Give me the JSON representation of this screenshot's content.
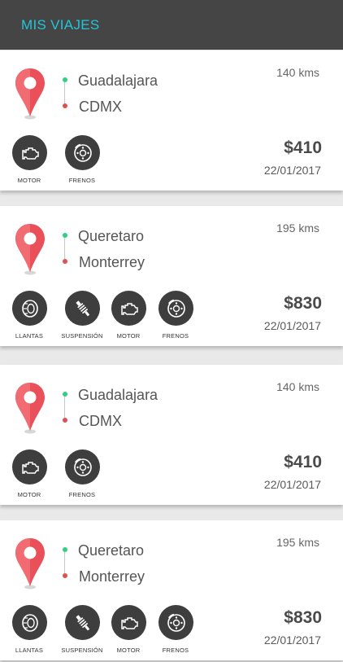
{
  "header": {
    "title": "MIS VIAJES"
  },
  "colors": {
    "accent": "#1fc6d8",
    "header_bg": "#454545",
    "origin_dot": "#2fd07e",
    "dest_dot": "#e05050",
    "pin": "#e9505a"
  },
  "trips": [
    {
      "origin": "Guadalajara",
      "destination": "CDMX",
      "distance": "140 kms",
      "price": "$410",
      "date": "22/01/2017",
      "parts": [
        {
          "label": "MOTOR",
          "icon": "engine-icon"
        },
        {
          "label": "FRENOS",
          "icon": "brake-disc-icon"
        }
      ]
    },
    {
      "origin": "Queretaro",
      "destination": "Monterrey",
      "distance": "195 kms",
      "price": "$830",
      "date": "22/01/2017",
      "parts": [
        {
          "label": "LLANTAS",
          "icon": "tire-icon"
        },
        {
          "label": "SUSPENSIÓN",
          "icon": "suspension-icon"
        },
        {
          "label": "MOTOR",
          "icon": "engine-icon"
        },
        {
          "label": "FRENOS",
          "icon": "brake-disc-icon"
        }
      ]
    },
    {
      "origin": "Guadalajara",
      "destination": "CDMX",
      "distance": "140 kms",
      "price": "$410",
      "date": "22/01/2017",
      "parts": [
        {
          "label": "MOTOR",
          "icon": "engine-icon"
        },
        {
          "label": "FRENOS",
          "icon": "brake-disc-icon"
        }
      ]
    },
    {
      "origin": "Queretaro",
      "destination": "Monterrey",
      "distance": "195 kms",
      "price": "$830",
      "date": "22/01/2017",
      "parts": [
        {
          "label": "LLANTAS",
          "icon": "tire-icon"
        },
        {
          "label": "SUSPENSIÓN",
          "icon": "suspension-icon"
        },
        {
          "label": "MOTOR",
          "icon": "engine-icon"
        },
        {
          "label": "FRENOS",
          "icon": "brake-disc-icon"
        }
      ]
    }
  ]
}
